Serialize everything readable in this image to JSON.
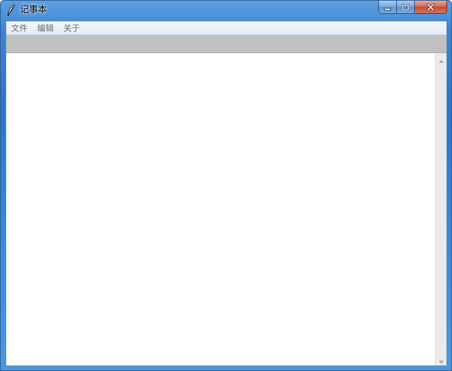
{
  "window": {
    "title": "记事本",
    "app_icon": "feather-quill-icon",
    "caption_buttons": [
      "minimize-icon",
      "maximize-icon",
      "close-icon"
    ]
  },
  "menubar": {
    "items": [
      {
        "label": "文件"
      },
      {
        "label": "编辑"
      },
      {
        "label": "关于"
      }
    ]
  },
  "editor": {
    "value": ""
  },
  "colors": {
    "titlebar_blue": "#3b86d6",
    "toolbar_gray": "#c0c0c0",
    "menu_text": "#6d6d6d",
    "close_red": "#c44a34"
  }
}
